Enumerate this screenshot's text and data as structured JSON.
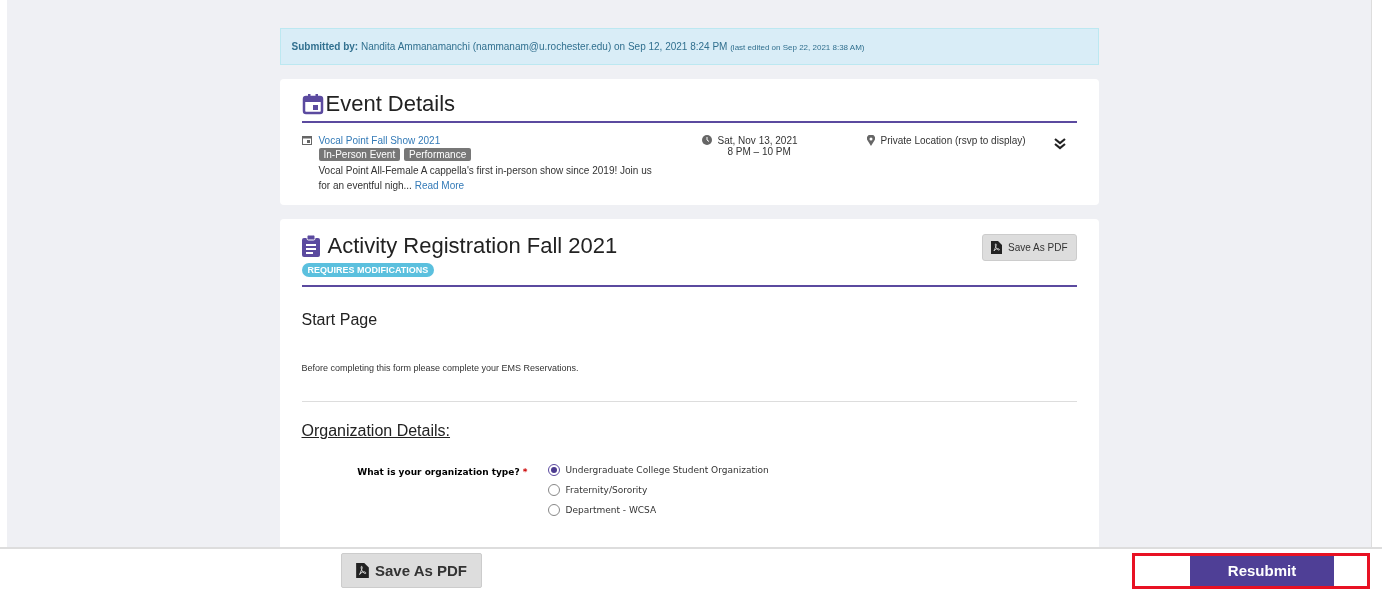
{
  "submission": {
    "label": "Submitted by:",
    "text": "Nandita Ammanamanchi (nammanam@u.rochester.edu) on Sep 12, 2021 8:24 PM",
    "edited": "(last edited on Sep 22, 2021 8:38 AM)"
  },
  "event_details": {
    "title": "Event Details",
    "event_name": "Vocal Point Fall Show 2021",
    "tags": [
      "In-Person Event",
      "Performance"
    ],
    "description": "Vocal Point All-Female A cappella's first in-person show since 2019! Join us for an eventful nigh...",
    "read_more": "Read More",
    "date": "Sat, Nov 13, 2021",
    "time": "8 PM – 10 PM",
    "location": "Private Location (rsvp to display)",
    "expanded": false
  },
  "form": {
    "title": "Activity Registration Fall 2021",
    "status": "REQUIRES MODIFICATIONS",
    "save_button": "Save As PDF",
    "page_title": "Start Page",
    "intro": "Before completing this form please complete your EMS Reservations.",
    "section_title": "Organization Details:",
    "question": {
      "label": "What is your organization type?",
      "required_mark": "*",
      "options": [
        {
          "label": "Undergraduate College Student Organization",
          "selected": true
        },
        {
          "label": "Fraternity/Sorority",
          "selected": false
        },
        {
          "label": "Department - WCSA",
          "selected": false
        }
      ]
    }
  },
  "footer": {
    "save_button": "Save As PDF",
    "resubmit_button": "Resubmit",
    "resubmit_highlighted": true
  }
}
